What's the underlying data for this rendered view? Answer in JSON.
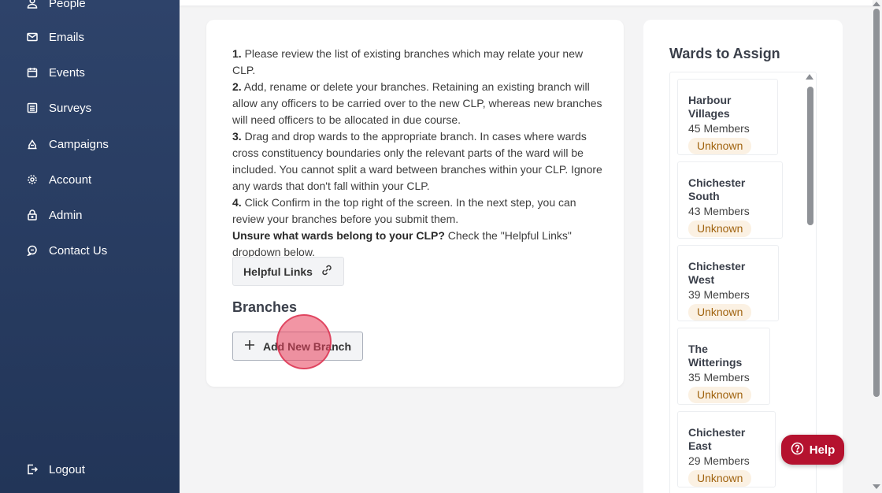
{
  "sidebar": {
    "items": [
      {
        "label": "People",
        "icon": "person-icon"
      },
      {
        "label": "Emails",
        "icon": "envelope-icon"
      },
      {
        "label": "Events",
        "icon": "calendar-icon"
      },
      {
        "label": "Surveys",
        "icon": "survey-icon"
      },
      {
        "label": "Campaigns",
        "icon": "campaign-icon"
      },
      {
        "label": "Account",
        "icon": "gear-icon"
      },
      {
        "label": "Admin",
        "icon": "lock-icon"
      },
      {
        "label": "Contact Us",
        "icon": "chat-icon"
      }
    ],
    "logout": {
      "label": "Logout",
      "icon": "logout-icon"
    }
  },
  "main": {
    "instructions": {
      "step1_num": "1.",
      "step1_text": " Please review the list of existing branches which may relate your new CLP.",
      "step2_num": "2.",
      "step2_text": " Add, rename or delete your branches. Retaining an existing branch will allow any officers to be carried over to the new CLP, whereas new branches will need officers to be allocated in due course.",
      "step3_num": "3.",
      "step3_text": " Drag and drop wards to the appropriate branch. In cases where wards cross constituency boundaries only the relevant parts of the ward will be included. You cannot split a ward between branches within your CLP. Ignore any wards that don't fall within your CLP.",
      "step4_num": "4.",
      "step4_text": " Click Confirm in the top right of the screen. In the next step, you can review your branches before you submit them.",
      "unsure_bold": "Unsure what wards belong to your CLP?",
      "unsure_text": " Check the \"Helpful Links\" dropdown below."
    },
    "helpful_links_label": "Helpful Links",
    "branches_title": "Branches",
    "add_branch_label": "Add New Branch"
  },
  "wards": {
    "title": "Wards to Assign",
    "items": [
      {
        "name": "Harbour Villages",
        "members": "45 Members",
        "status": "Unknown"
      },
      {
        "name": "Chichester South",
        "members": "43 Members",
        "status": "Unknown"
      },
      {
        "name": "Chichester West",
        "members": "39 Members",
        "status": "Unknown"
      },
      {
        "name": "The Witterings",
        "members": "35 Members",
        "status": "Unknown"
      },
      {
        "name": "Chichester East",
        "members": "29 Members",
        "status": "Unknown"
      }
    ]
  },
  "help": {
    "label": "Help",
    "icon": "question-circle-icon"
  },
  "colors": {
    "sidebar": "#2e436a",
    "help": "#b5122f",
    "badge_bg": "#fbf1e3",
    "badge_text": "#a0630f"
  }
}
